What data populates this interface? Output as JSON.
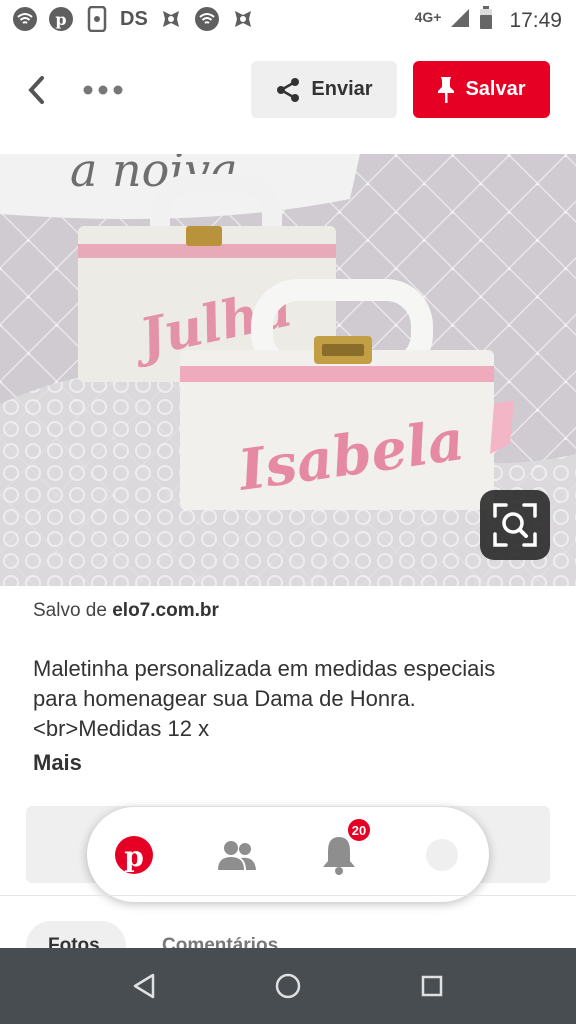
{
  "status_bar": {
    "network": "4G+",
    "time": "17:49",
    "left_label": "DS"
  },
  "toolbar": {
    "send_label": "Enviar",
    "save_label": "Salvar"
  },
  "pin": {
    "source_prefix": "Salvo de ",
    "source_domain": "elo7.com.br",
    "description": "Maletinha personalizada em medidas especiais para homenagear sua Dama de Honra. <br>Medidas 12 x",
    "more_label": "Mais"
  },
  "nav": {
    "notification_count": "20"
  },
  "tabs": {
    "photos_label": "Fotos",
    "comments_label": "Comentários"
  },
  "colors": {
    "brand_red": "#e60023",
    "android_nav": "#474d51"
  }
}
